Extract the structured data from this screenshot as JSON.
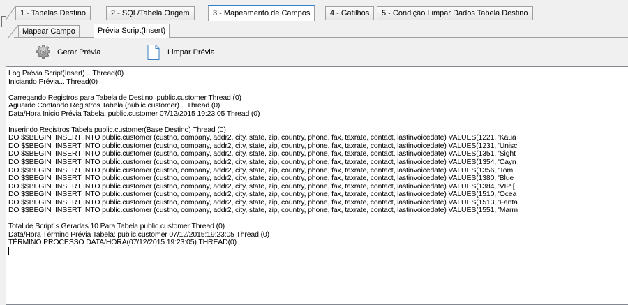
{
  "main_tabs": [
    {
      "label": "1 - Tabelas Destino",
      "active": false
    },
    {
      "label": "2 - SQL/Tabela Origem",
      "active": false
    },
    {
      "label": "3 - Mapeamento de Campos",
      "active": true
    },
    {
      "label": "4 - Gatilhos",
      "active": false
    },
    {
      "label": "5 - Condição Limpar Dados Tabela Destino",
      "active": false
    }
  ],
  "sub_tabs": [
    {
      "label": "Mapear Campo",
      "active": false
    },
    {
      "label": "Prévia Script(Insert)",
      "active": true
    }
  ],
  "toolbar": {
    "gerar_label": "Gerar Prévia",
    "gerar_icon": "gear-icon",
    "limpar_label": "Limpar Prévia",
    "limpar_icon": "blank-document-icon"
  },
  "log_lines": [
    "Log Prévia Script(Insert)... Thread(0)",
    "Iniciando Prévia... Thread(0)",
    "",
    "Carregando Registros para Tabela de Destino: public.customer Thread (0)",
    "Aguarde Contando Registros Tabela (public.customer)... Thread (0)",
    "Data/Hora Inicio Prévia Tabela: public.customer 07/12/2015 19:23:05 Thread (0)",
    "",
    "Inserindo Registros Tabela public.customer(Base Destino) Thread (0)",
    "DO $$BEGIN  INSERT INTO public.customer (custno, company, addr2, city, state, zip, country, phone, fax, taxrate, contact, lastinvoicedate) VALUES(1221, 'Kaua",
    "DO $$BEGIN  INSERT INTO public.customer (custno, company, addr2, city, state, zip, country, phone, fax, taxrate, contact, lastinvoicedate) VALUES(1231, 'Unisc",
    "DO $$BEGIN  INSERT INTO public.customer (custno, company, addr2, city, state, zip, country, phone, fax, taxrate, contact, lastinvoicedate) VALUES(1351, 'Sight",
    "DO $$BEGIN  INSERT INTO public.customer (custno, company, addr2, city, state, zip, country, phone, fax, taxrate, contact, lastinvoicedate) VALUES(1354, 'Cayn",
    "DO $$BEGIN  INSERT INTO public.customer (custno, company, addr2, city, state, zip, country, phone, fax, taxrate, contact, lastinvoicedate) VALUES(1356, 'Tom",
    "DO $$BEGIN  INSERT INTO public.customer (custno, company, addr2, city, state, zip, country, phone, fax, taxrate, contact, lastinvoicedate) VALUES(1380, 'Blue",
    "DO $$BEGIN  INSERT INTO public.customer (custno, company, addr2, city, state, zip, country, phone, fax, taxrate, contact, lastinvoicedate) VALUES(1384, 'VIP [",
    "DO $$BEGIN  INSERT INTO public.customer (custno, company, addr2, city, state, zip, country, phone, fax, taxrate, contact, lastinvoicedate) VALUES(1510, 'Ocea",
    "DO $$BEGIN  INSERT INTO public.customer (custno, company, addr2, city, state, zip, country, phone, fax, taxrate, contact, lastinvoicedate) VALUES(1513, 'Fanta",
    "DO $$BEGIN  INSERT INTO public.customer (custno, company, addr2, city, state, zip, country, phone, fax, taxrate, contact, lastinvoicedate) VALUES(1551, 'Marm",
    "",
    "Total de Script´s Geradas 10 Para Tabela public.customer Thread (0)",
    "Data/Hora Término Prévia Tabela: public.customer 07/12/2015:19:23:05 Thread (0)",
    "TÉRMINO PROCESSO DATA/HORA(07/12/2015 19:23:05) THREAD(0)",
    ""
  ],
  "colors": {
    "active_tab_accent": "#2a7fd0",
    "window_bg": "#f0f0f0",
    "memo_bg": "#ffffff"
  }
}
